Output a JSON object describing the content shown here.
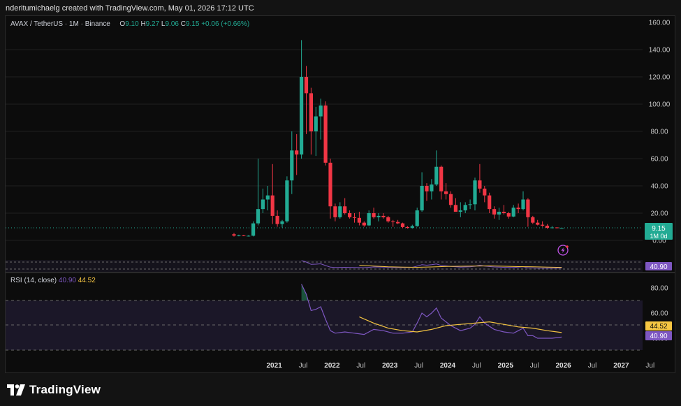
{
  "caption": "nderitumichaelg created with TradingView.com, May 01, 2026 17:12 UTC",
  "legend": {
    "symbol": "AVAX / TetherUS · 1M · Binance",
    "o_label": "O",
    "o": "9.10",
    "h_label": "H",
    "h": "9.27",
    "l_label": "L",
    "l": "9.06",
    "c_label": "C",
    "c": "9.15",
    "change": "+0.06 (+0.66%)"
  },
  "price_badge": {
    "value": "9.15",
    "sub": "1M 0d"
  },
  "rsi_legend": {
    "title": "RSI (14, close)",
    "rsi": "40.90",
    "ma": "44.52"
  },
  "rsi_badges": {
    "ma": "44.52",
    "rsi": "40.90"
  },
  "mini_badge": "40.90",
  "brand": "TradingView",
  "colors": {
    "up": "#22ab94",
    "down": "#f23645",
    "rsi": "#7e57c2",
    "rsi_ma": "#f5c542",
    "background": "#0c0c0c",
    "band": "#1e1a2e"
  },
  "chart_data": [
    {
      "type": "candlestick",
      "title": "AVAX / TetherUS · 1M · Binance",
      "x_labels": [
        "2021",
        "Jul",
        "2022",
        "Jul",
        "2023",
        "Jul",
        "2024",
        "Jul",
        "2025",
        "Jul",
        "2026",
        "Jul",
        "2027",
        "Jul"
      ],
      "ylim": [
        0,
        160
      ],
      "y_ticks": [
        "0.00",
        "20.00",
        "40.00",
        "60.00",
        "80.00",
        "100.00",
        "120.00",
        "140.00",
        "160.00"
      ],
      "grid": true,
      "candles": [
        {
          "date": "2020-09",
          "o": 4.5,
          "h": 5.5,
          "l": 2.8,
          "c": 3.5
        },
        {
          "date": "2020-10",
          "o": 3.5,
          "h": 4.2,
          "l": 3.0,
          "c": 3.6
        },
        {
          "date": "2020-11",
          "o": 3.6,
          "h": 4.0,
          "l": 3.1,
          "c": 3.2
        },
        {
          "date": "2020-12",
          "o": 3.2,
          "h": 3.8,
          "l": 2.8,
          "c": 3.4
        },
        {
          "date": "2021-01",
          "o": 3.4,
          "h": 14,
          "l": 2.9,
          "c": 12.5
        },
        {
          "date": "2021-02",
          "o": 12.5,
          "h": 60,
          "l": 11,
          "c": 23
        },
        {
          "date": "2021-03",
          "o": 23,
          "h": 38,
          "l": 20,
          "c": 30
        },
        {
          "date": "2021-04",
          "o": 30,
          "h": 40,
          "l": 22,
          "c": 33
        },
        {
          "date": "2021-05",
          "o": 33,
          "h": 56,
          "l": 12,
          "c": 18
        },
        {
          "date": "2021-06",
          "o": 18,
          "h": 22,
          "l": 10,
          "c": 12
        },
        {
          "date": "2021-07",
          "o": 12,
          "h": 15,
          "l": 9.5,
          "c": 14
        },
        {
          "date": "2021-08",
          "o": 14,
          "h": 47,
          "l": 13,
          "c": 44
        },
        {
          "date": "2021-09",
          "o": 44,
          "h": 80,
          "l": 34,
          "c": 66
        },
        {
          "date": "2021-10",
          "o": 66,
          "h": 78,
          "l": 48,
          "c": 63
        },
        {
          "date": "2021-11",
          "o": 63,
          "h": 147,
          "l": 60,
          "c": 120
        },
        {
          "date": "2021-12",
          "o": 120,
          "h": 128,
          "l": 78,
          "c": 108
        },
        {
          "date": "2022-01",
          "o": 108,
          "h": 112,
          "l": 63,
          "c": 80
        },
        {
          "date": "2022-02",
          "o": 80,
          "h": 98,
          "l": 62,
          "c": 91
        },
        {
          "date": "2022-03",
          "o": 91,
          "h": 104,
          "l": 74,
          "c": 99
        },
        {
          "date": "2022-04",
          "o": 99,
          "h": 102,
          "l": 55,
          "c": 57
        },
        {
          "date": "2022-05",
          "o": 57,
          "h": 60,
          "l": 16,
          "c": 25
        },
        {
          "date": "2022-06",
          "o": 25,
          "h": 27,
          "l": 14,
          "c": 17
        },
        {
          "date": "2022-07",
          "o": 17,
          "h": 28,
          "l": 16,
          "c": 25
        },
        {
          "date": "2022-08",
          "o": 25,
          "h": 31,
          "l": 19,
          "c": 20
        },
        {
          "date": "2022-09",
          "o": 20,
          "h": 22,
          "l": 16,
          "c": 17
        },
        {
          "date": "2022-10",
          "o": 17,
          "h": 20,
          "l": 13,
          "c": 16.5
        },
        {
          "date": "2022-11",
          "o": 16.5,
          "h": 21,
          "l": 11,
          "c": 13
        },
        {
          "date": "2022-12",
          "o": 13,
          "h": 14,
          "l": 10,
          "c": 11
        },
        {
          "date": "2023-01",
          "o": 11,
          "h": 22,
          "l": 10.5,
          "c": 20
        },
        {
          "date": "2023-02",
          "o": 20,
          "h": 24,
          "l": 16,
          "c": 17
        },
        {
          "date": "2023-03",
          "o": 17,
          "h": 20,
          "l": 14,
          "c": 18
        },
        {
          "date": "2023-04",
          "o": 18,
          "h": 20,
          "l": 16,
          "c": 17
        },
        {
          "date": "2023-05",
          "o": 17,
          "h": 18,
          "l": 13,
          "c": 14
        },
        {
          "date": "2023-06",
          "o": 14,
          "h": 15,
          "l": 10,
          "c": 13.5
        },
        {
          "date": "2023-07",
          "o": 13.5,
          "h": 15,
          "l": 12,
          "c": 12.5
        },
        {
          "date": "2023-08",
          "o": 12.5,
          "h": 13,
          "l": 9,
          "c": 9.8
        },
        {
          "date": "2023-09",
          "o": 9.8,
          "h": 10.5,
          "l": 8.6,
          "c": 9.2
        },
        {
          "date": "2023-10",
          "o": 9.2,
          "h": 11.5,
          "l": 8.6,
          "c": 10.5
        },
        {
          "date": "2023-11",
          "o": 10.5,
          "h": 24,
          "l": 10,
          "c": 22
        },
        {
          "date": "2023-12",
          "o": 22,
          "h": 50,
          "l": 21,
          "c": 40
        },
        {
          "date": "2024-01",
          "o": 40,
          "h": 42,
          "l": 29,
          "c": 36
        },
        {
          "date": "2024-02",
          "o": 36,
          "h": 45,
          "l": 30,
          "c": 41
        },
        {
          "date": "2024-03",
          "o": 41,
          "h": 66,
          "l": 40,
          "c": 54
        },
        {
          "date": "2024-04",
          "o": 54,
          "h": 55,
          "l": 30,
          "c": 36
        },
        {
          "date": "2024-05",
          "o": 36,
          "h": 42,
          "l": 30,
          "c": 34
        },
        {
          "date": "2024-06",
          "o": 34,
          "h": 36,
          "l": 24,
          "c": 26
        },
        {
          "date": "2024-07",
          "o": 26,
          "h": 31,
          "l": 22,
          "c": 21
        },
        {
          "date": "2024-08",
          "o": 21,
          "h": 28,
          "l": 17,
          "c": 22
        },
        {
          "date": "2024-09",
          "o": 22,
          "h": 28,
          "l": 20,
          "c": 26
        },
        {
          "date": "2024-10",
          "o": 26,
          "h": 30,
          "l": 23,
          "c": 26.5
        },
        {
          "date": "2024-11",
          "o": 26.5,
          "h": 46,
          "l": 22,
          "c": 44
        },
        {
          "date": "2024-12",
          "o": 44,
          "h": 56,
          "l": 35,
          "c": 38
        },
        {
          "date": "2025-01",
          "o": 38,
          "h": 40,
          "l": 28,
          "c": 33
        },
        {
          "date": "2025-02",
          "o": 33,
          "h": 35,
          "l": 20,
          "c": 23
        },
        {
          "date": "2025-03",
          "o": 23,
          "h": 25,
          "l": 16,
          "c": 19
        },
        {
          "date": "2025-04",
          "o": 19,
          "h": 24,
          "l": 15,
          "c": 21
        },
        {
          "date": "2025-05",
          "o": 21,
          "h": 26,
          "l": 19,
          "c": 20
        },
        {
          "date": "2025-06",
          "o": 20,
          "h": 21,
          "l": 16,
          "c": 17.5
        },
        {
          "date": "2025-07",
          "o": 17.5,
          "h": 26,
          "l": 17,
          "c": 24
        },
        {
          "date": "2025-08",
          "o": 24,
          "h": 27,
          "l": 20,
          "c": 23
        },
        {
          "date": "2025-09",
          "o": 23,
          "h": 36,
          "l": 22,
          "c": 30
        },
        {
          "date": "2025-10",
          "o": 30,
          "h": 31,
          "l": 10,
          "c": 17
        },
        {
          "date": "2025-11",
          "o": 17,
          "h": 18,
          "l": 12,
          "c": 13
        },
        {
          "date": "2025-12",
          "o": 13,
          "h": 15,
          "l": 11,
          "c": 11.5
        },
        {
          "date": "2026-01",
          "o": 11.5,
          "h": 14,
          "l": 10,
          "c": 10.8
        },
        {
          "date": "2026-02",
          "o": 10.8,
          "h": 12,
          "l": 8.5,
          "c": 9.2
        },
        {
          "date": "2026-03",
          "o": 9.2,
          "h": 10.5,
          "l": 8.7,
          "c": 9.5
        },
        {
          "date": "2026-04",
          "o": 9.5,
          "h": 9.7,
          "l": 8.8,
          "c": 9.1
        },
        {
          "date": "2026-05",
          "o": 9.1,
          "h": 9.27,
          "l": 9.06,
          "c": 9.15
        }
      ]
    },
    {
      "type": "line",
      "title": "RSI (14, close)",
      "ylim": [
        30,
        90
      ],
      "y_ticks": [
        "40.00",
        "60.00",
        "80.00"
      ],
      "bands": [
        30,
        50,
        70
      ],
      "series": [
        {
          "name": "RSI",
          "x": [
            "2021-11",
            "2021-12",
            "2022-01",
            "2022-02",
            "2022-03",
            "2022-04",
            "2022-05",
            "2022-06",
            "2022-08",
            "2022-10",
            "2022-12",
            "2023-02",
            "2023-04",
            "2023-06",
            "2023-08",
            "2023-10",
            "2023-11",
            "2023-12",
            "2024-01",
            "2024-02",
            "2024-03",
            "2024-04",
            "2024-06",
            "2024-08",
            "2024-10",
            "2024-11",
            "2024-12",
            "2025-01",
            "2025-03",
            "2025-05",
            "2025-07",
            "2025-08",
            "2025-09",
            "2025-10",
            "2025-11",
            "2025-12",
            "2026-01",
            "2026-03",
            "2026-05"
          ],
          "values": [
            83,
            75,
            62,
            63,
            65,
            55,
            46,
            44,
            45,
            44,
            43,
            47,
            46,
            44,
            44,
            45,
            52,
            60,
            57,
            60,
            64,
            56,
            50,
            46,
            48,
            51,
            57,
            52,
            47,
            45,
            44,
            46,
            48,
            42,
            42,
            40,
            40,
            40,
            40.9
          ]
        },
        {
          "name": "MA",
          "x": [
            "2022-11",
            "2023-02",
            "2023-05",
            "2023-08",
            "2023-11",
            "2024-02",
            "2024-05",
            "2024-08",
            "2024-11",
            "2025-02",
            "2025-05",
            "2025-08",
            "2025-11",
            "2026-02",
            "2026-05"
          ],
          "values": [
            57,
            52,
            48,
            46,
            45,
            47,
            50,
            51,
            52,
            53,
            51,
            49,
            48,
            46,
            44.52
          ]
        }
      ]
    }
  ]
}
